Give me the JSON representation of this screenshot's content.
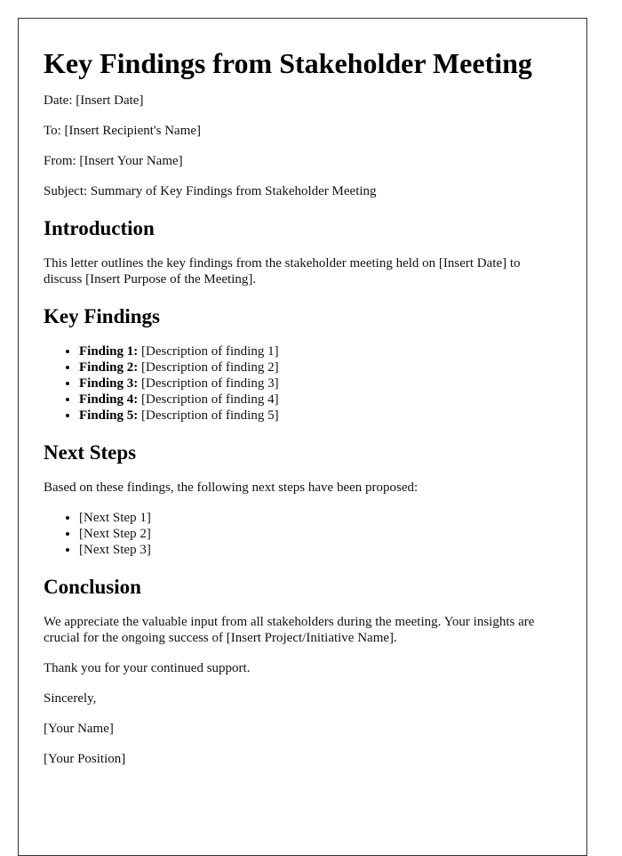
{
  "title": "Key Findings from Stakeholder Meeting",
  "meta": {
    "date": "Date: [Insert Date]",
    "to": "To: [Insert Recipient's Name]",
    "from": "From: [Insert Your Name]",
    "subject": "Subject: Summary of Key Findings from Stakeholder Meeting"
  },
  "introduction": {
    "heading": "Introduction",
    "text": "This letter outlines the key findings from the stakeholder meeting held on [Insert Date] to discuss [Insert Purpose of the Meeting]."
  },
  "key_findings": {
    "heading": "Key Findings",
    "items": [
      {
        "label": "Finding 1:",
        "text": " [Description of finding 1]"
      },
      {
        "label": "Finding 2:",
        "text": " [Description of finding 2]"
      },
      {
        "label": "Finding 3:",
        "text": " [Description of finding 3]"
      },
      {
        "label": "Finding 4:",
        "text": " [Description of finding 4]"
      },
      {
        "label": "Finding 5:",
        "text": " [Description of finding 5]"
      }
    ]
  },
  "next_steps": {
    "heading": "Next Steps",
    "intro": "Based on these findings, the following next steps have been proposed:",
    "items": [
      "[Next Step 1]",
      "[Next Step 2]",
      "[Next Step 3]"
    ]
  },
  "conclusion": {
    "heading": "Conclusion",
    "text": "We appreciate the valuable input from all stakeholders during the meeting. Your insights are crucial for the ongoing success of [Insert Project/Initiative Name].",
    "thanks": "Thank you for your continued support."
  },
  "closing": {
    "signoff": "Sincerely,",
    "name": "[Your Name]",
    "position": "[Your Position]"
  }
}
